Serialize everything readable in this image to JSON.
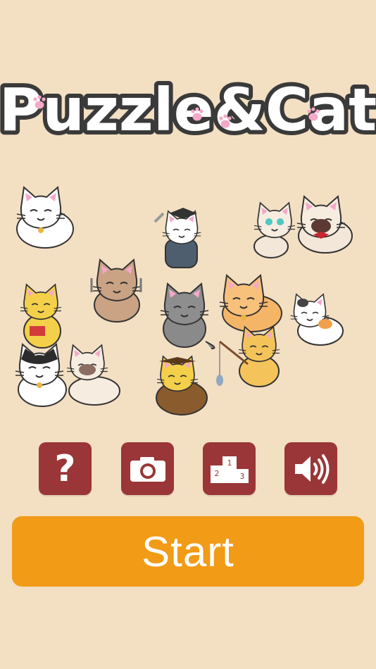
{
  "logo": {
    "text_part1": "Puzzle",
    "text_amp": "&",
    "text_part2": "Cat"
  },
  "toolbar": {
    "help_label": "?",
    "rank_labels": [
      "1",
      "2",
      "3"
    ]
  },
  "start_label": "Start",
  "colors": {
    "background": "#f3dfc2",
    "icon_button": "#9a3637",
    "start_button": "#f29b17",
    "logo_outline": "#3a3a3a",
    "paw_pink": "#f4a9c8"
  },
  "icons": [
    "help-icon",
    "camera-icon",
    "ranking-icon",
    "sound-icon"
  ]
}
